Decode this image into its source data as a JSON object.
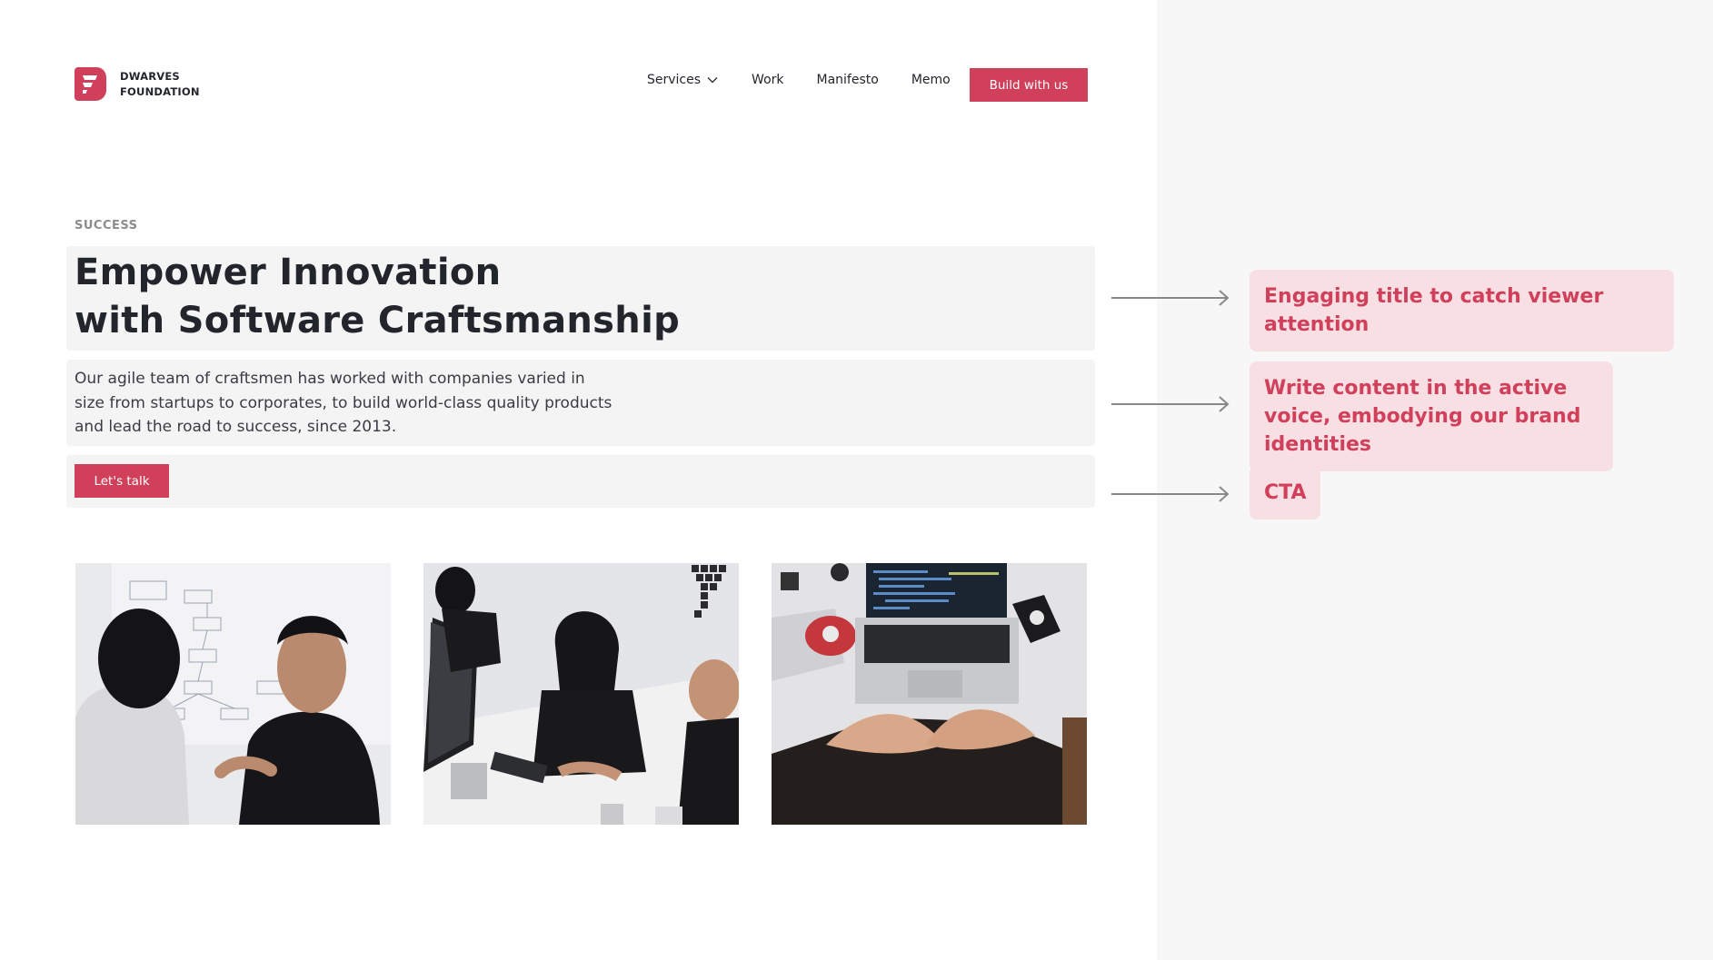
{
  "brand": {
    "name_line1": "DWARVES",
    "name_line2": "FOUNDATION",
    "logo_icon": "dwarves-logo-icon",
    "accent_color": "#d1405b"
  },
  "nav": {
    "items": [
      {
        "label": "Services",
        "has_dropdown": true
      },
      {
        "label": "Work"
      },
      {
        "label": "Manifesto"
      },
      {
        "label": "Memo"
      }
    ],
    "cta_label": "Build with us"
  },
  "hero": {
    "eyebrow": "SUCCESS",
    "title_line1": "Empower Innovation",
    "title_line2": "with Software Craftsmanship",
    "description": "Our agile team of craftsmen has worked with companies varied in size from startups to corporates, to build world-class quality products and lead the road to success, since 2013.",
    "cta_label": "Let's talk"
  },
  "photos": [
    {
      "icon": "team-whiteboard-photo"
    },
    {
      "icon": "team-office-photo"
    },
    {
      "icon": "laptop-desk-photo"
    }
  ],
  "annotations": [
    {
      "text": "Engaging title to catch viewer attention"
    },
    {
      "text": "Write content in the active voice, embodying our brand identities"
    },
    {
      "text": "CTA"
    }
  ]
}
